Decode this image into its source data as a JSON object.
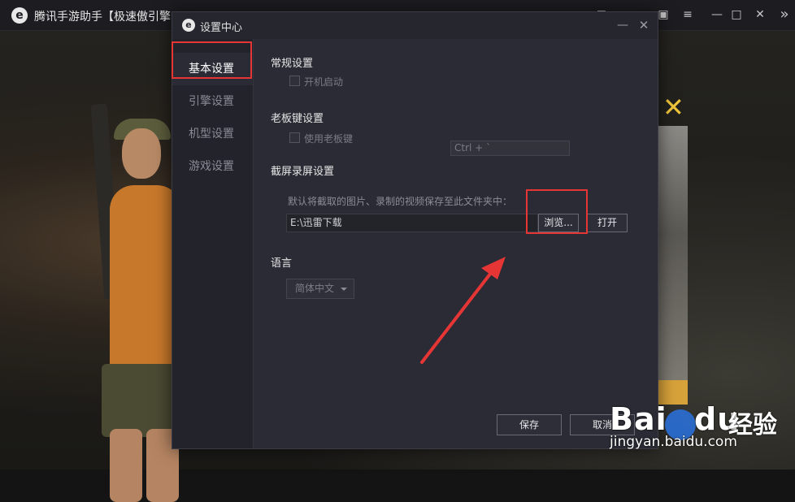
{
  "main_window": {
    "title": "腾讯手游助手【极速傲引擎",
    "logo_letter": "e",
    "controls": [
      "✉",
      "▣",
      "≡",
      "—",
      "□",
      "✕"
    ],
    "side_toggle": "»",
    "banner_close": "✕"
  },
  "dialog": {
    "title": "设置中心",
    "logo_letter": "e",
    "minimize": "—",
    "close": "✕",
    "nav": [
      {
        "label": "基本设置",
        "active": true
      },
      {
        "label": "引擎设置",
        "active": false
      },
      {
        "label": "机型设置",
        "active": false
      },
      {
        "label": "游戏设置",
        "active": false
      }
    ],
    "general": {
      "title": "常规设置",
      "autostart_label": "开机启动",
      "autostart_checked": false
    },
    "boss_key": {
      "title": "老板键设置",
      "enable_label": "使用老板键",
      "enabled": false,
      "hotkey": "Ctrl + `"
    },
    "screenshot": {
      "title": "截屏录屏设置",
      "description": "默认将截取的图片、录制的视频保存至此文件夹中：",
      "path": "E:\\迅雷下载",
      "browse_label": "浏览...",
      "open_label": "打开"
    },
    "language": {
      "title": "语言",
      "selected": "简体中文"
    },
    "footer": {
      "save_label": "保存",
      "cancel_label": "取消"
    }
  },
  "annotations": {
    "highlight_color": "#e53535"
  },
  "watermark": {
    "logo_text": "Bai",
    "logo_text2": "du",
    "cn_text": "经验",
    "url": "jingyan.baidu.com"
  }
}
